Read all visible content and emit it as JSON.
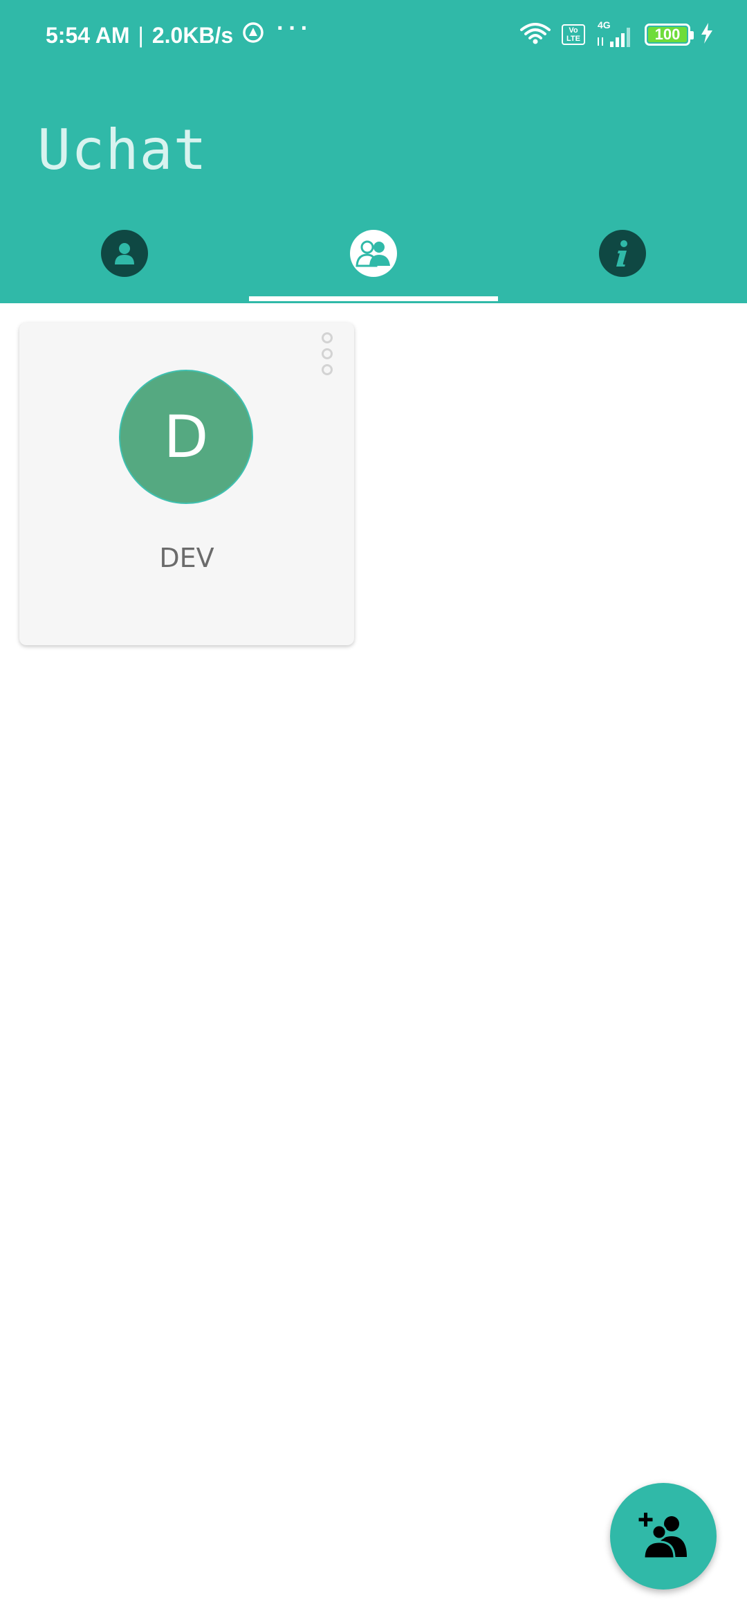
{
  "status_bar": {
    "time": "5:54 AM",
    "separator": "|",
    "network_speed": "2.0KB/s",
    "more_indicator": "···",
    "volte_top": "Vo",
    "volte_bottom": "LTE",
    "network_type": "4G",
    "battery": "100"
  },
  "app": {
    "title": "Uchat"
  },
  "tabs": [
    {
      "name": "contacts",
      "icon": "person-icon",
      "selected": false
    },
    {
      "name": "groups",
      "icon": "group-icon",
      "selected": true
    },
    {
      "name": "info",
      "icon": "info-icon",
      "selected": false
    }
  ],
  "groups": [
    {
      "initial": "D",
      "name": "DEV"
    }
  ],
  "fab": {
    "icon": "add-group-icon"
  },
  "colors": {
    "primary": "#30b9a8",
    "tab_icon_dark": "#0f4843",
    "avatar": "#55a981",
    "card": "#f6f6f6"
  }
}
